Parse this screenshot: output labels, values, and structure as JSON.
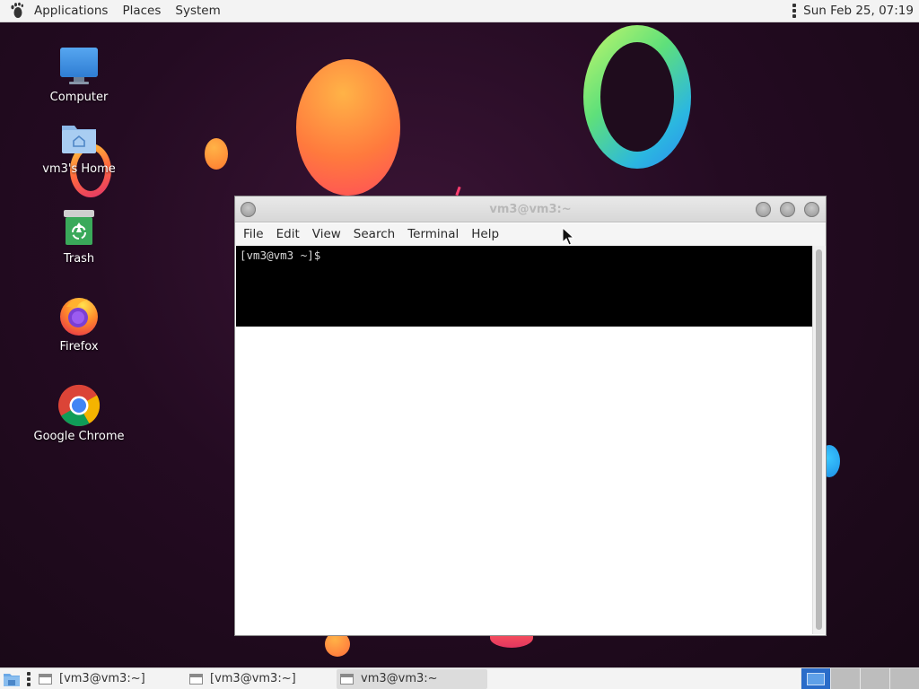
{
  "top_panel": {
    "menus": [
      "Applications",
      "Places",
      "System"
    ],
    "clock": "Sun Feb 25, 07:19"
  },
  "desktop": {
    "icons": [
      {
        "label": "Computer",
        "icon": "computer-icon"
      },
      {
        "label": "vm3's Home",
        "icon": "home-folder-icon"
      },
      {
        "label": "Trash",
        "icon": "trash-icon"
      },
      {
        "label": "Firefox",
        "icon": "firefox-icon"
      },
      {
        "label": "Google Chrome",
        "icon": "chrome-icon"
      }
    ]
  },
  "terminal": {
    "title": "vm3@vm3:~",
    "menu": [
      "File",
      "Edit",
      "View",
      "Search",
      "Terminal",
      "Help"
    ],
    "prompt": "[vm3@vm3 ~]$"
  },
  "taskbar": {
    "tasks": [
      {
        "label": "[vm3@vm3:~]",
        "active": false
      },
      {
        "label": "[vm3@vm3:~]",
        "active": false
      },
      {
        "label": "vm3@vm3:~",
        "active": true
      }
    ],
    "workspace_count": 4,
    "active_workspace": 1
  },
  "colors": {
    "accent": "#2a6cc9",
    "terminal_bg": "#000000",
    "panel_bg": "#f3f3f3"
  }
}
